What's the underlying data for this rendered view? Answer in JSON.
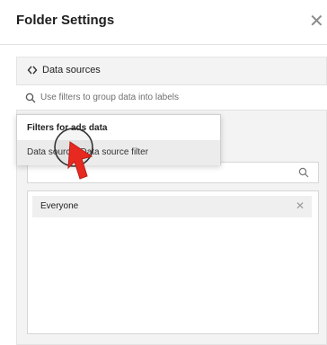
{
  "dialog": {
    "title": "Folder Settings"
  },
  "data_sources": {
    "label": "Data sources",
    "icon": "chevrons-icon"
  },
  "search": {
    "placeholder": "Use filters to group data into labels"
  },
  "dropdown": {
    "header": "Filters for ads data",
    "items": [
      {
        "label": "Data source: Data source filter"
      }
    ]
  },
  "selected_list": {
    "items": [
      {
        "label": "Everyone"
      }
    ]
  },
  "colors": {
    "cursor_red": "#e8291f",
    "panel_bg": "#f3f3f3"
  }
}
